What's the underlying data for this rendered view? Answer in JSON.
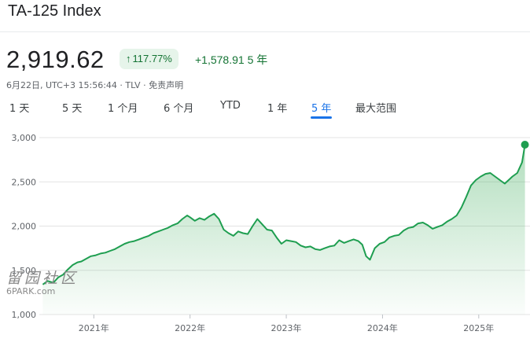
{
  "header": {
    "title": "TA-125 Index",
    "price": "2,919.62",
    "change_pct": "117.77%",
    "change_abs": "+1,578.91",
    "period_label": "5 年",
    "meta_date": "6月22日, UTC+3 15:56:44",
    "meta_exchange": "TLV",
    "meta_disclaimer": "免责声明"
  },
  "tabs": [
    {
      "label": "1 天"
    },
    {
      "label": "5 天"
    },
    {
      "label": "1 个月"
    },
    {
      "label": "6 个月"
    },
    {
      "label": "YTD"
    },
    {
      "label": "1 年"
    },
    {
      "label": "5 年",
      "active": true
    },
    {
      "label": "最大范围"
    }
  ],
  "watermark": {
    "cn": "留园社区",
    "en": "6PARK.com"
  },
  "colors": {
    "line": "#1e9e50",
    "positive": "#137333",
    "accent": "#1a73e8"
  },
  "chart_data": {
    "type": "area",
    "ylim": [
      1000,
      3000
    ],
    "yticks": [
      1000,
      1500,
      2000,
      2500,
      3000
    ],
    "ytick_labels": [
      "1,000",
      "1,500",
      "2,000",
      "2,500",
      "3,000"
    ],
    "xticks": [
      2021,
      2022,
      2023,
      2024,
      2025
    ],
    "xtick_labels": [
      "2021年",
      "2022年",
      "2023年",
      "2024年",
      "2025年"
    ],
    "grid": true,
    "series": [
      {
        "x": [
          2020.47,
          2020.52,
          2020.58,
          2020.63,
          2020.68,
          2020.73,
          2020.78,
          2020.83,
          2020.87,
          2020.92,
          2020.97,
          2021.02,
          2021.07,
          2021.12,
          2021.17,
          2021.22,
          2021.27,
          2021.32,
          2021.37,
          2021.42,
          2021.47,
          2021.52,
          2021.57,
          2021.62,
          2021.67,
          2021.72,
          2021.77,
          2021.82,
          2021.87,
          2021.92,
          2021.97,
          2022.0,
          2022.05,
          2022.1,
          2022.15,
          2022.2,
          2022.25,
          2022.3,
          2022.35,
          2022.4,
          2022.45,
          2022.5,
          2022.55,
          2022.6,
          2022.65,
          2022.7,
          2022.75,
          2022.8,
          2022.85,
          2022.9,
          2022.95,
          2023.0,
          2023.05,
          2023.1,
          2023.15,
          2023.2,
          2023.25,
          2023.3,
          2023.35,
          2023.4,
          2023.45,
          2023.5,
          2023.55,
          2023.6,
          2023.65,
          2023.7,
          2023.75,
          2023.79,
          2023.83,
          2023.87,
          2023.92,
          2023.97,
          2024.02,
          2024.07,
          2024.12,
          2024.17,
          2024.22,
          2024.27,
          2024.32,
          2024.37,
          2024.42,
          2024.47,
          2024.52,
          2024.57,
          2024.62,
          2024.67,
          2024.72,
          2024.77,
          2024.82,
          2024.87,
          2024.92,
          2024.97,
          2025.02,
          2025.07,
          2025.12,
          2025.17,
          2025.22,
          2025.27,
          2025.32,
          2025.35,
          2025.4,
          2025.45,
          2025.48
        ],
        "y": [
          1340,
          1380,
          1360,
          1420,
          1450,
          1510,
          1560,
          1590,
          1600,
          1630,
          1660,
          1670,
          1690,
          1700,
          1720,
          1740,
          1770,
          1800,
          1820,
          1830,
          1850,
          1870,
          1890,
          1920,
          1940,
          1960,
          1980,
          2010,
          2030,
          2080,
          2120,
          2100,
          2060,
          2090,
          2070,
          2110,
          2140,
          2080,
          1960,
          1920,
          1890,
          1940,
          1920,
          1910,
          2000,
          2080,
          2020,
          1960,
          1950,
          1870,
          1800,
          1840,
          1830,
          1820,
          1780,
          1760,
          1770,
          1740,
          1730,
          1750,
          1770,
          1780,
          1840,
          1810,
          1830,
          1850,
          1830,
          1790,
          1660,
          1620,
          1750,
          1800,
          1820,
          1870,
          1890,
          1900,
          1950,
          1980,
          1990,
          2030,
          2040,
          2010,
          1970,
          1990,
          2010,
          2050,
          2080,
          2120,
          2210,
          2330,
          2460,
          2520,
          2560,
          2590,
          2600,
          2560,
          2520,
          2480,
          2530,
          2560,
          2600,
          2720,
          2920
        ]
      }
    ]
  }
}
